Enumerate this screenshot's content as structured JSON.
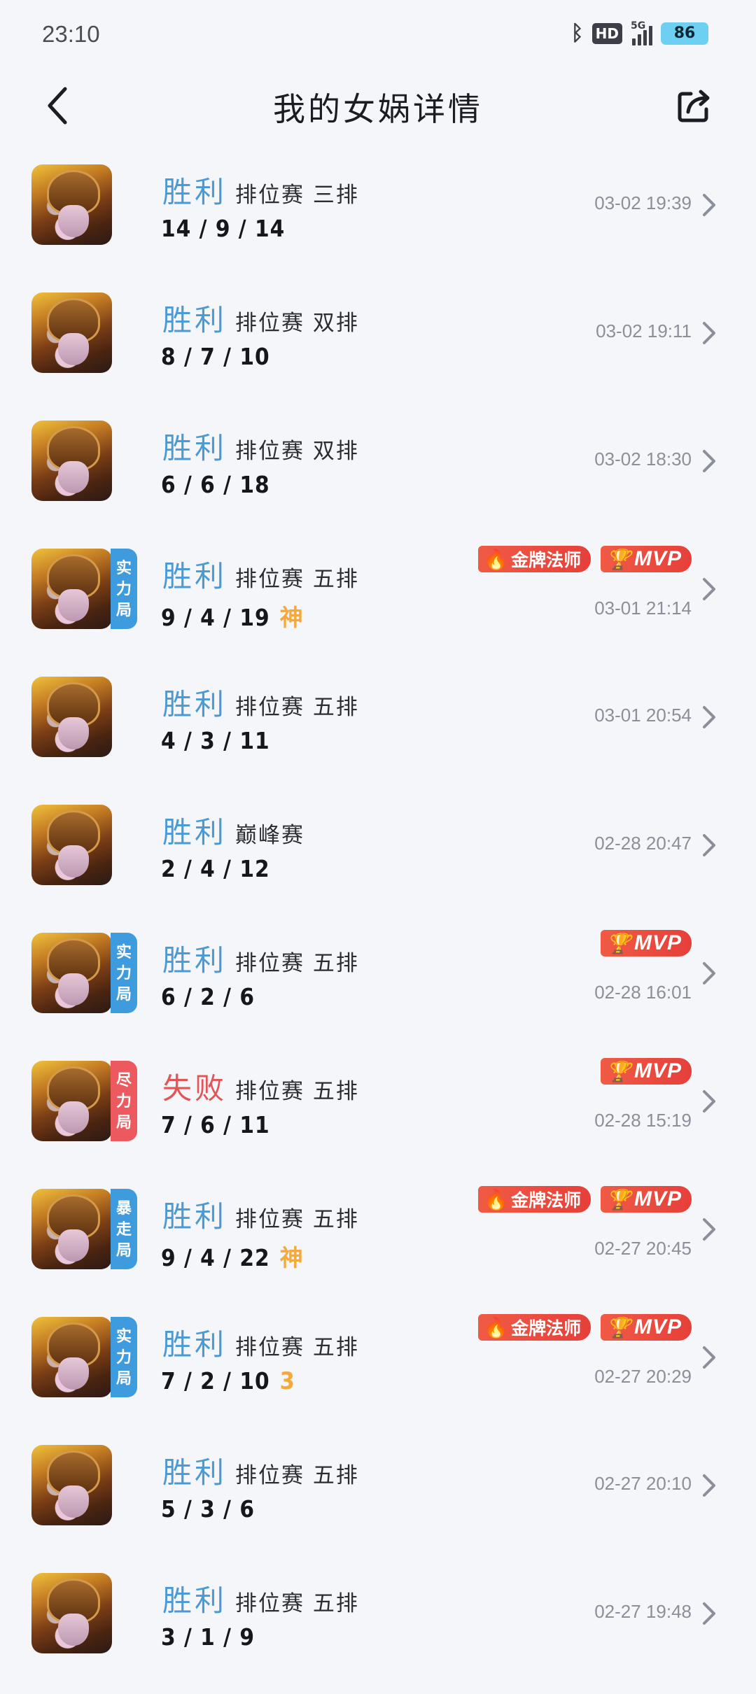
{
  "status_bar": {
    "time": "23:10",
    "network": "5G",
    "hd_label": "HD",
    "battery": "86",
    "bluetooth": "ᛒ"
  },
  "header": {
    "title": "我的女娲详情"
  },
  "matches": [
    {
      "result": "胜利",
      "outcome": "win",
      "mode": "排位赛 三排",
      "kda": "14 / 9 / 14",
      "time": "03-02 19:39",
      "badge": "",
      "badge_color": "",
      "tag": "",
      "awards": []
    },
    {
      "result": "胜利",
      "outcome": "win",
      "mode": "排位赛 双排",
      "kda": "8 / 7 / 10",
      "time": "03-02 19:11",
      "badge": "",
      "badge_color": "",
      "tag": "",
      "awards": []
    },
    {
      "result": "胜利",
      "outcome": "win",
      "mode": "排位赛 双排",
      "kda": "6 / 6 / 18",
      "time": "03-02 18:30",
      "badge": "",
      "badge_color": "",
      "tag": "",
      "awards": []
    },
    {
      "result": "胜利",
      "outcome": "win",
      "mode": "排位赛 五排",
      "kda": "9 / 4 / 19",
      "time": "03-01 21:14",
      "badge": "实力局",
      "badge_color": "blue",
      "tag": "神",
      "awards": [
        "金牌法师",
        "MVP"
      ]
    },
    {
      "result": "胜利",
      "outcome": "win",
      "mode": "排位赛 五排",
      "kda": "4 / 3 / 11",
      "time": "03-01 20:54",
      "badge": "",
      "badge_color": "",
      "tag": "",
      "awards": []
    },
    {
      "result": "胜利",
      "outcome": "win",
      "mode": "巅峰赛",
      "kda": "2 / 4 / 12",
      "time": "02-28 20:47",
      "badge": "",
      "badge_color": "",
      "tag": "",
      "awards": []
    },
    {
      "result": "胜利",
      "outcome": "win",
      "mode": "排位赛 五排",
      "kda": "6 / 2 / 6",
      "time": "02-28 16:01",
      "badge": "实力局",
      "badge_color": "blue",
      "tag": "",
      "awards": [
        "MVP"
      ]
    },
    {
      "result": "失败",
      "outcome": "lose",
      "mode": "排位赛 五排",
      "kda": "7 / 6 / 11",
      "time": "02-28 15:19",
      "badge": "尽力局",
      "badge_color": "red",
      "tag": "",
      "awards": [
        "MVP"
      ]
    },
    {
      "result": "胜利",
      "outcome": "win",
      "mode": "排位赛 五排",
      "kda": "9 / 4 / 22",
      "time": "02-27 20:45",
      "badge": "暴走局",
      "badge_color": "blue",
      "tag": "神",
      "awards": [
        "金牌法师",
        "MVP"
      ]
    },
    {
      "result": "胜利",
      "outcome": "win",
      "mode": "排位赛 五排",
      "kda": "7 / 2 / 10",
      "time": "02-27 20:29",
      "badge": "实力局",
      "badge_color": "blue",
      "tag": "3",
      "awards": [
        "金牌法师",
        "MVP"
      ]
    },
    {
      "result": "胜利",
      "outcome": "win",
      "mode": "排位赛 五排",
      "kda": "5 / 3 / 6",
      "time": "02-27 20:10",
      "badge": "",
      "badge_color": "",
      "tag": "",
      "awards": []
    },
    {
      "result": "胜利",
      "outcome": "win",
      "mode": "排位赛 五排",
      "kda": "3 / 1 / 9",
      "time": "02-27 19:48",
      "badge": "",
      "badge_color": "",
      "tag": "",
      "awards": []
    }
  ],
  "colors": {
    "win": "#4a9ad5",
    "lose": "#e25557",
    "award_bg": "#e8473c",
    "tag": "#f3a93b",
    "background": "#f5f6fa"
  }
}
